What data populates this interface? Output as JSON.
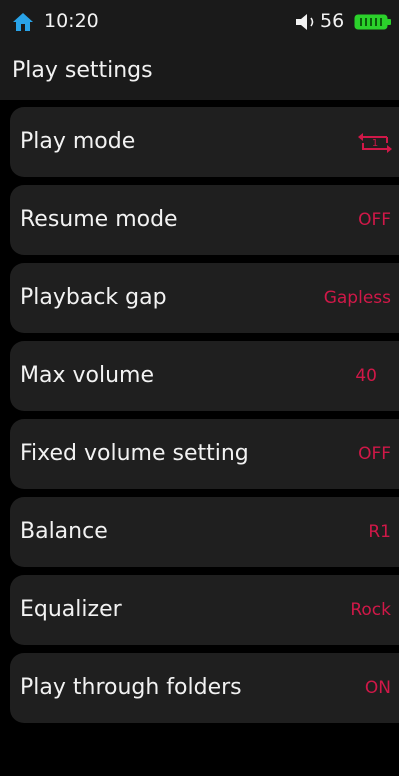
{
  "status_bar": {
    "time": "10:20",
    "volume": "56",
    "icons": [
      "home-icon",
      "speaker-icon",
      "battery-icon"
    ],
    "home_icon_color": "#29a3e8",
    "battery_color": "#2bd12b"
  },
  "header": {
    "title": "Play settings"
  },
  "accent_color": "#d01848",
  "settings": [
    {
      "label": "Play mode",
      "value_icon": "repeat-one-icon"
    },
    {
      "label": "Resume mode",
      "value": "OFF"
    },
    {
      "label": "Playback gap",
      "value": "Gapless"
    },
    {
      "label": "Max volume",
      "value": "40"
    },
    {
      "label": "Fixed volume setting",
      "value": "OFF"
    },
    {
      "label": "Balance",
      "value": "R1"
    },
    {
      "label": "Equalizer",
      "value": "Rock"
    },
    {
      "label": "Play through folders",
      "value": "ON"
    }
  ]
}
